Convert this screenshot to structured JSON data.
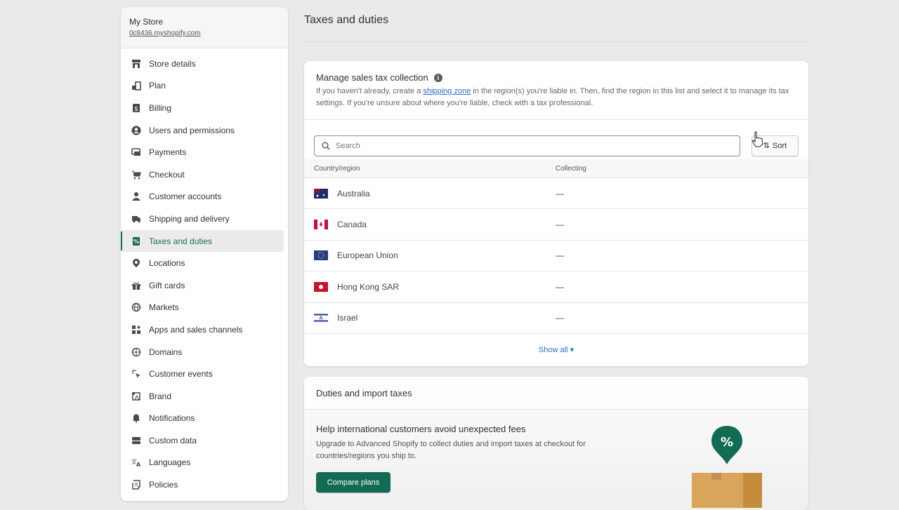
{
  "sidebar": {
    "store_name": "My Store",
    "store_url": "0c8436.myshopify.com",
    "items": [
      {
        "label": "Store details",
        "icon": "store-icon"
      },
      {
        "label": "Plan",
        "icon": "plan-icon"
      },
      {
        "label": "Billing",
        "icon": "billing-icon"
      },
      {
        "label": "Users and permissions",
        "icon": "user-icon"
      },
      {
        "label": "Payments",
        "icon": "payments-icon"
      },
      {
        "label": "Checkout",
        "icon": "cart-icon"
      },
      {
        "label": "Customer accounts",
        "icon": "person-icon"
      },
      {
        "label": "Shipping and delivery",
        "icon": "truck-icon"
      },
      {
        "label": "Taxes and duties",
        "icon": "tax-icon",
        "active": true
      },
      {
        "label": "Locations",
        "icon": "location-icon"
      },
      {
        "label": "Gift cards",
        "icon": "gift-icon"
      },
      {
        "label": "Markets",
        "icon": "globe-icon"
      },
      {
        "label": "Apps and sales channels",
        "icon": "apps-icon"
      },
      {
        "label": "Domains",
        "icon": "domain-icon"
      },
      {
        "label": "Customer events",
        "icon": "cursor-click-icon"
      },
      {
        "label": "Brand",
        "icon": "brand-icon"
      },
      {
        "label": "Notifications",
        "icon": "bell-icon"
      },
      {
        "label": "Custom data",
        "icon": "database-icon"
      },
      {
        "label": "Languages",
        "icon": "translate-icon"
      },
      {
        "label": "Policies",
        "icon": "policy-icon"
      }
    ]
  },
  "main": {
    "title": "Taxes and duties",
    "sales_tax": {
      "title": "Manage sales tax collection",
      "desc_before": "If you haven't already, create a ",
      "desc_link": "shipping zone",
      "desc_after": " in the region(s) you're liable in. Then, find the region in this list and select it to manage its tax settings. If you're unsure about where you're liable, check with a tax professional.",
      "search_placeholder": "Search",
      "sort_label": "Sort",
      "columns": [
        "Country/region",
        "Collecting"
      ],
      "rows": [
        {
          "country": "Australia",
          "collecting": "—",
          "flag": "au"
        },
        {
          "country": "Canada",
          "collecting": "—",
          "flag": "ca"
        },
        {
          "country": "European Union",
          "collecting": "—",
          "flag": "eu"
        },
        {
          "country": "Hong Kong SAR",
          "collecting": "—",
          "flag": "hk"
        },
        {
          "country": "Israel",
          "collecting": "—",
          "flag": "il"
        }
      ],
      "show_all": "Show all"
    },
    "duties": {
      "title": "Duties and import taxes",
      "heading": "Help international customers avoid unexpected fees",
      "desc": "Upgrade to Advanced Shopify to collect duties and import taxes at checkout for countries/regions you ship to.",
      "button": "Compare plans"
    }
  },
  "colors": {
    "accent": "#136b53",
    "link": "#2c6ecb"
  }
}
